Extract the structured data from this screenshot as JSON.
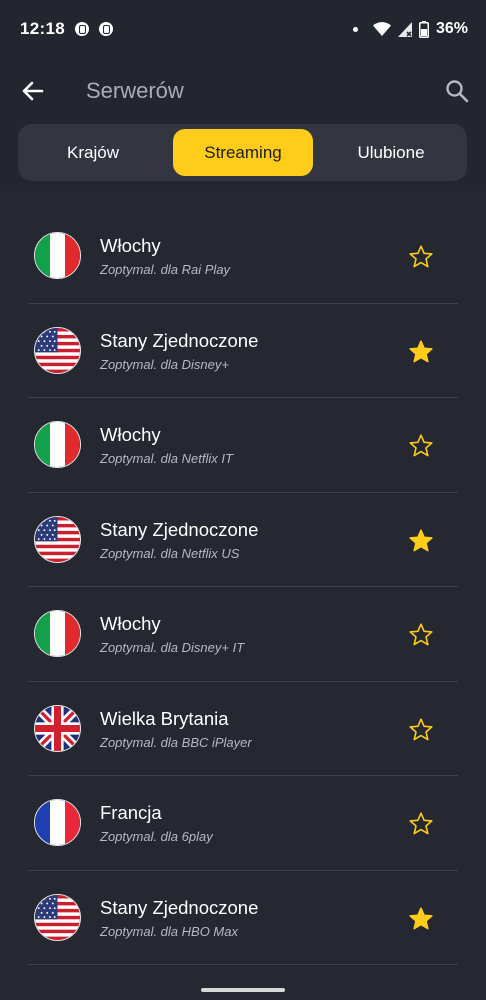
{
  "status_bar": {
    "time": "12:18",
    "battery": "36%",
    "icons": [
      "notification-icon",
      "notification-icon",
      "dot",
      "wifi-icon",
      "signal-icon",
      "battery-icon"
    ]
  },
  "app_bar": {
    "title": "Serwerów",
    "back_icon": "arrow-left-icon",
    "search_icon": "search-icon"
  },
  "tabs": [
    {
      "label": "Krajów",
      "active": false
    },
    {
      "label": "Streaming",
      "active": true
    },
    {
      "label": "Ulubione",
      "active": false
    }
  ],
  "colors": {
    "background": "#252831",
    "accent": "#ffcc1a",
    "star_filled": "#ffcc1a"
  },
  "servers": [
    {
      "country": "Włochy",
      "service": "Zoptymal. dla Rai Play",
      "flag": "italy",
      "favorite": false
    },
    {
      "country": "Stany Zjednoczone",
      "service": "Zoptymal. dla Disney+",
      "flag": "usa",
      "favorite": true
    },
    {
      "country": "Włochy",
      "service": "Zoptymal. dla Netflix IT",
      "flag": "italy",
      "favorite": false
    },
    {
      "country": "Stany Zjednoczone",
      "service": "Zoptymal. dla Netflix US",
      "flag": "usa",
      "favorite": true
    },
    {
      "country": "Włochy",
      "service": "Zoptymal. dla Disney+ IT",
      "flag": "italy",
      "favorite": false
    },
    {
      "country": "Wielka Brytania",
      "service": "Zoptymal. dla BBC iPlayer",
      "flag": "uk",
      "favorite": false
    },
    {
      "country": "Francja",
      "service": "Zoptymal. dla 6play",
      "flag": "france",
      "favorite": false
    },
    {
      "country": "Stany Zjednoczone",
      "service": "Zoptymal. dla HBO Max",
      "flag": "usa",
      "favorite": true
    }
  ]
}
